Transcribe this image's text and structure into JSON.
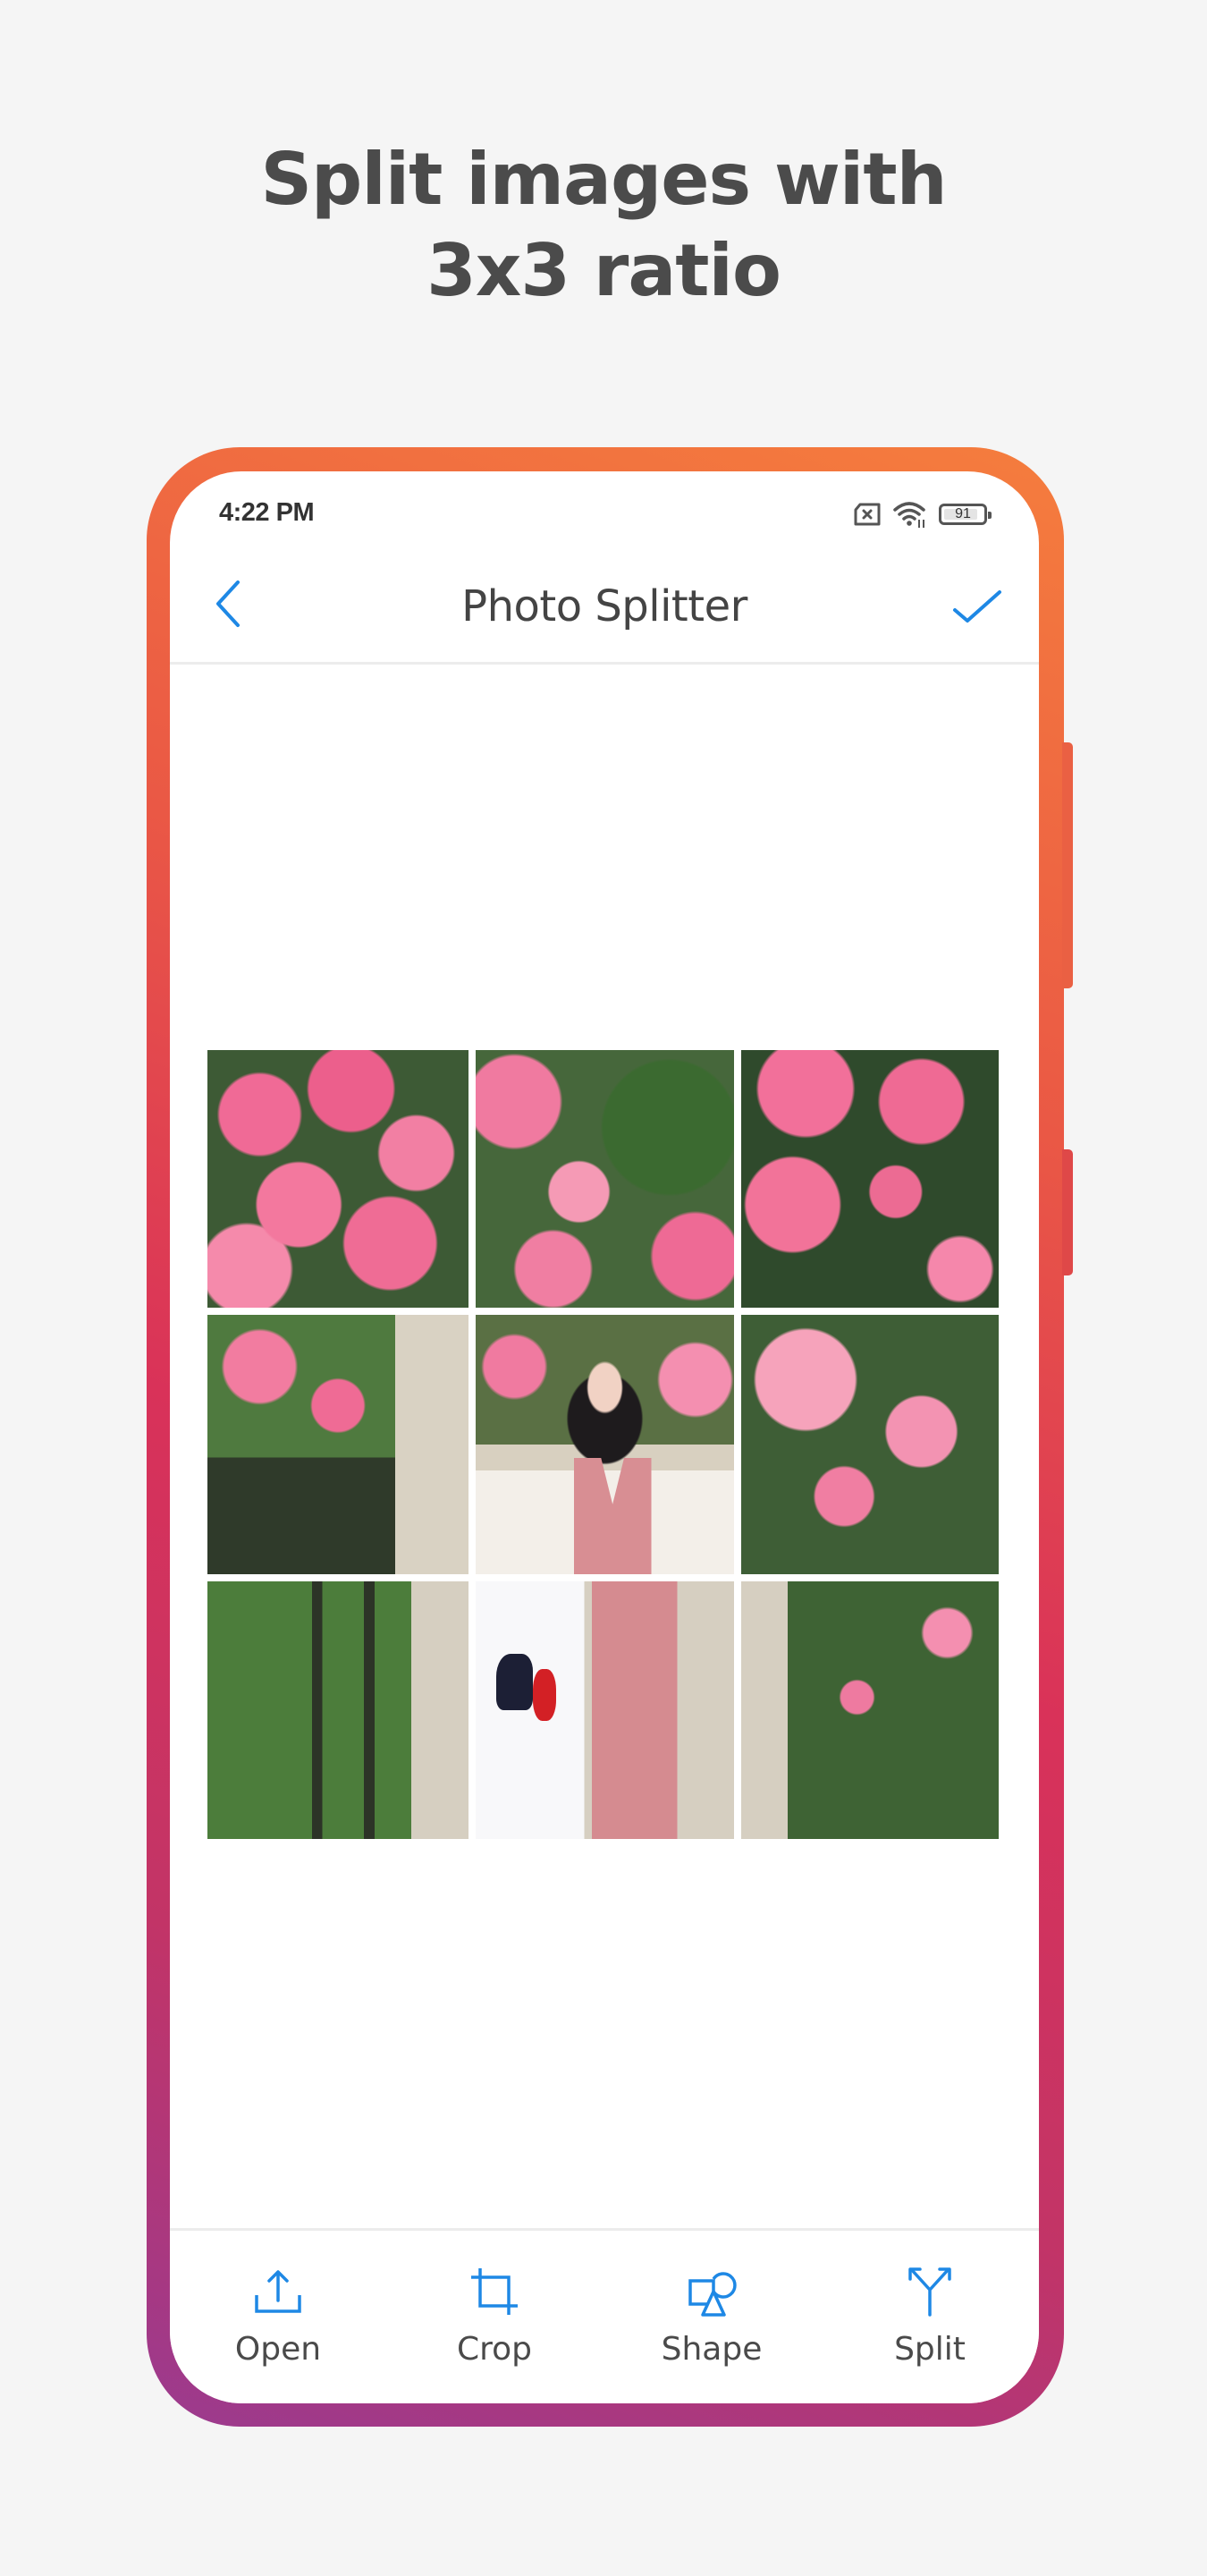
{
  "headline": {
    "line1": "Split images with",
    "line2": "3x3 ratio"
  },
  "status_bar": {
    "time": "4:22 PM",
    "icons": [
      "sim-off-icon",
      "wifi-icon",
      "battery-icon"
    ],
    "battery_level": "91"
  },
  "nav": {
    "title": "Photo Splitter",
    "back_icon": "chevron-left-icon",
    "done_icon": "checkmark-icon"
  },
  "grid": {
    "rows": 3,
    "columns": 3,
    "tiles": [
      {
        "row": 1,
        "col": 1,
        "description": "pink bougainvillea flowers"
      },
      {
        "row": 1,
        "col": 2,
        "description": "pink flowers and green leaves"
      },
      {
        "row": 1,
        "col": 3,
        "description": "pink flowers on dark foliage"
      },
      {
        "row": 2,
        "col": 1,
        "description": "flowers over iron fence"
      },
      {
        "row": 2,
        "col": 2,
        "description": "smiling woman with long dark hair"
      },
      {
        "row": 2,
        "col": 3,
        "description": "pink flowers and leaves"
      },
      {
        "row": 3,
        "col": 1,
        "description": "green plants behind lattice fence"
      },
      {
        "row": 3,
        "col": 2,
        "description": "woman holding white tote bag in pink dress"
      },
      {
        "row": 3,
        "col": 3,
        "description": "stone pillar and foliage"
      }
    ]
  },
  "toolbar": {
    "items": [
      {
        "label": "Open",
        "icon": "upload-icon"
      },
      {
        "label": "Crop",
        "icon": "crop-icon"
      },
      {
        "label": "Shape",
        "icon": "shapes-icon"
      },
      {
        "label": "Split",
        "icon": "split-icon"
      }
    ]
  },
  "colors": {
    "accent": "#1e88e5",
    "frame_gradient_top": "#f57d3d",
    "frame_gradient_mid": "#d93259",
    "frame_gradient_bottom": "#9b3a8e",
    "background": "#f5f5f5",
    "text": "#4b4b4b"
  }
}
